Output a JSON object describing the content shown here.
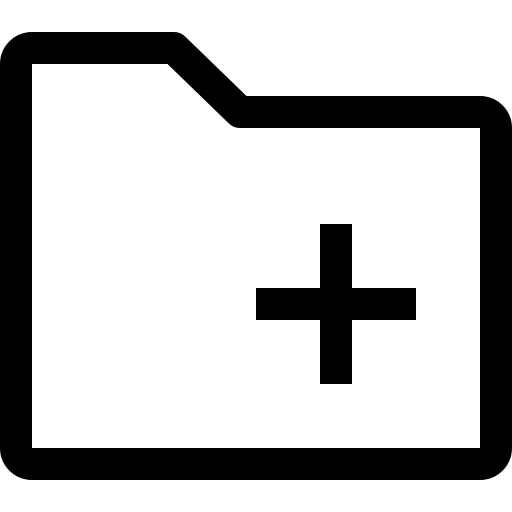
{
  "icon": {
    "name": "folder-add-icon",
    "stroke_color": "#000000",
    "background_color": "#ffffff"
  }
}
